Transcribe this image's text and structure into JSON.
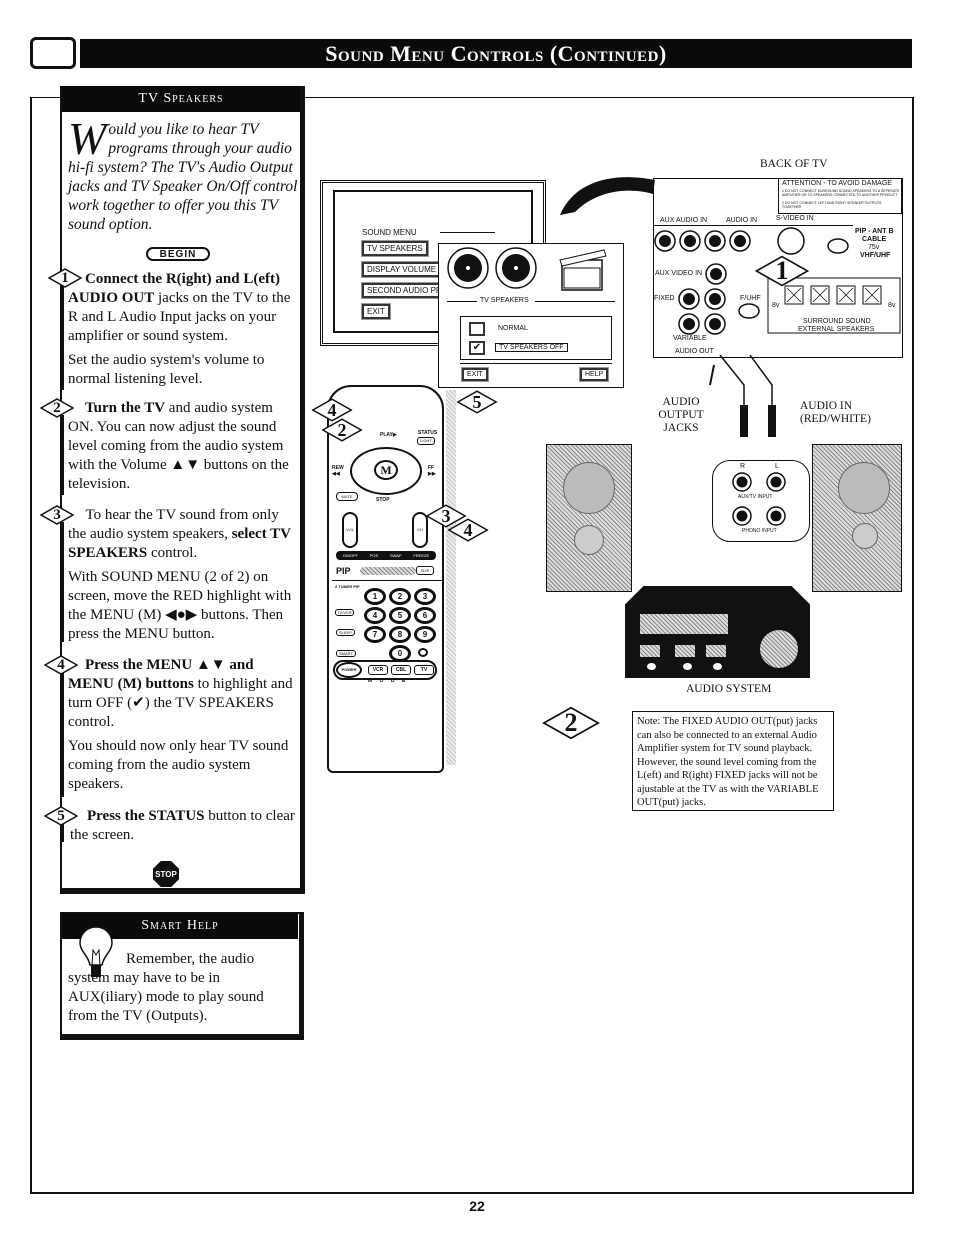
{
  "page": {
    "title": "Sound Menu Controls (Continued)",
    "page_number": "22"
  },
  "tv_speakers": {
    "header": "TV Speakers",
    "intro_dropcap": "W",
    "intro": "ould you like to hear TV programs through your audio hi-fi system? The TV's Audio Output jacks and TV Speaker On/Off control work together to offer you this TV sound option.",
    "begin_label": "BEGIN",
    "steps": [
      {
        "number": "1",
        "bold1": "Connect the R(ight) and L(eft) AUDIO OUT",
        "text1": " jacks on the TV to the R and L Audio Input jacks on your amplifier or sound system.",
        "para2": "Set the audio system's volume to normal listening level."
      },
      {
        "number": "2",
        "bold1": "Turn the TV",
        "text1": " and audio system ON. You can now adjust the sound level coming from the audio system with the Volume ▲▼ buttons on the television."
      },
      {
        "number": "3",
        "text0": " To hear the TV sound from only the audio system speakers, ",
        "bold1": "select TV SPEAKERS",
        "text1": " control.",
        "para2": "With SOUND MENU (2 of 2) on screen, move the RED highlight with the MENU (M) ◀●▶ buttons. Then press the MENU button."
      },
      {
        "number": "4",
        "bold1": "Press the MENU ▲▼ and MENU (M) buttons",
        "text1": " to highlight and turn OFF (✔) the TV SPEAKERS control.",
        "para2": "You should now only hear TV sound coming from the audio system speakers."
      },
      {
        "number": "5",
        "bold1": "Press the STATUS",
        "text1": " button to clear the screen."
      }
    ],
    "stop_label": "STOP"
  },
  "smart_help": {
    "header": "Smart Help",
    "text": "Remember, the audio system may have to be in AUX(iliary) mode to play sound from the TV (Outputs)."
  },
  "diagram": {
    "sound_menu": {
      "title": "SOUND MENU",
      "items": [
        "TV SPEAKERS",
        "DISPLAY VOLUME",
        "SECOND AUDIO PR",
        "EXIT"
      ]
    },
    "tv_speakers_menu": {
      "title": "TV SPEAKERS",
      "options": [
        {
          "label": "NORMAL",
          "checked": false
        },
        {
          "label": "TV SPEAKERS OFF",
          "checked": true
        }
      ],
      "exit_label": "EXIT",
      "help_label": "HELP"
    },
    "back_of_tv_label": "BACK OF TV",
    "attention": {
      "title": "ATTENTION - TO AVOID DAMAGE",
      "lines": [
        "1  DO NOT CONNECT SURROUND SOUND SPEAKERS TO A SEPERATE AMPLIFIER OR TO SPEAKERS CONNECTED TO ANOTHER PRODUCT",
        "2  DO NOT CONNECT LEFT AND RIGHT SPEAKER OUTPUTS TOGETHER"
      ]
    },
    "jack_labels": {
      "aux_audio_in": "AUX AUDIO IN",
      "audio_in": "AUDIO IN",
      "s_video_in": "S-VIDEO IN",
      "aux_video_in": "AUX VIDEO IN",
      "fixed": "FIXED",
      "variable": "VARIABLE",
      "audio_out": "AUDIO OUT",
      "r": "R",
      "l": "L",
      "pip_ant": "PIP - ANT B",
      "cable": "CABLE",
      "ohms": "75v",
      "vhf_uhf": "VHF/UHF",
      "uhf_partial": "F/UHF",
      "eight_v": "8v",
      "surround_sound": "SURROUND SOUND",
      "external_speakers": "EXTERNAL SPEAKERS"
    },
    "audio_output_jacks": "AUDIO OUTPUT JACKS",
    "audio_in_red_white": "AUDIO IN (RED/WHITE)",
    "aux_tv_input": "AUX/TV INPUT",
    "phono_input": "PHONO INPUT",
    "audio_system": "AUDIO SYSTEM",
    "remote": {
      "play": "PLAY▶",
      "status": "STATUS",
      "light": "LIGHT",
      "rew": "REW ◀◀",
      "ff": "FF ▶▶",
      "menu": "M",
      "mute": "MUTE",
      "stop": "STOP",
      "vol": "VOL",
      "ch": "CH",
      "pip_row": [
        "ON/OFF",
        "POS",
        "SWAP",
        "FREEZE"
      ],
      "pip": "PIP",
      "size": "SIZE",
      "two_tuner_pip": "2 TUNER PIP",
      "tv_vcr": "TV/VCR",
      "sleep": "SLEEP",
      "smart": "SMART",
      "power": "POWER",
      "digits": [
        "1",
        "2",
        "3",
        "4",
        "5",
        "6",
        "7",
        "8",
        "9",
        "0"
      ],
      "mode_buttons": [
        "VCR",
        "CBL",
        "TV"
      ],
      "mode_label": "M O D E"
    },
    "callouts": [
      "1",
      "2",
      "2",
      "3",
      "4",
      "4",
      "5"
    ],
    "note": "Note: The FIXED AUDIO OUT(put) jacks can also be connected to an external Audio Amplifier system for TV sound playback. However, the sound level coming from the L(eft) and R(ight) FIXED jacks will not be ajustable at the TV as with the VARIABLE OUT(put) jacks."
  }
}
